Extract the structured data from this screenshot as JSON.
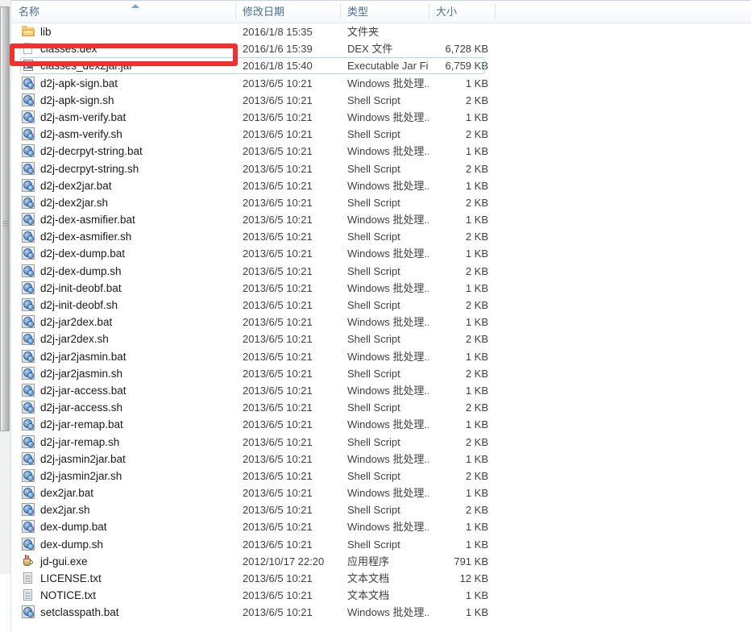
{
  "window": {
    "scrollbar": {
      "orientation": "vertical",
      "position": "left"
    }
  },
  "columns": [
    {
      "key": "name",
      "label": "名称",
      "sorted": "asc"
    },
    {
      "key": "date",
      "label": "修改日期",
      "sorted": ""
    },
    {
      "key": "type",
      "label": "类型",
      "sorted": ""
    },
    {
      "key": "size",
      "label": "大小",
      "sorted": ""
    }
  ],
  "annotation": {
    "color": "#f23030",
    "target": "classes.dex",
    "shape": "rectangle"
  },
  "focused_row": "classes_dex2jar.jar",
  "files": [
    {
      "name": "lib",
      "date": "2016/1/8 15:35",
      "type": "文件夹",
      "size": "",
      "icon": "folder-icon"
    },
    {
      "name": "classes.dex",
      "date": "2016/1/6 15:39",
      "type": "DEX 文件",
      "size": "6,728 KB",
      "icon": "document-icon"
    },
    {
      "name": "classes_dex2jar.jar",
      "date": "2016/1/8 15:40",
      "type": "Executable Jar File",
      "size": "6,759 KB",
      "icon": "jar-icon"
    },
    {
      "name": "d2j-apk-sign.bat",
      "date": "2013/6/5 10:21",
      "type": "Windows 批处理...",
      "size": "1 KB",
      "icon": "batch-script-icon"
    },
    {
      "name": "d2j-apk-sign.sh",
      "date": "2013/6/5 10:21",
      "type": "Shell Script",
      "size": "2 KB",
      "icon": "shell-script-icon"
    },
    {
      "name": "d2j-asm-verify.bat",
      "date": "2013/6/5 10:21",
      "type": "Windows 批处理...",
      "size": "1 KB",
      "icon": "batch-script-icon"
    },
    {
      "name": "d2j-asm-verify.sh",
      "date": "2013/6/5 10:21",
      "type": "Shell Script",
      "size": "2 KB",
      "icon": "shell-script-icon"
    },
    {
      "name": "d2j-decrpyt-string.bat",
      "date": "2013/6/5 10:21",
      "type": "Windows 批处理...",
      "size": "1 KB",
      "icon": "batch-script-icon"
    },
    {
      "name": "d2j-decrpyt-string.sh",
      "date": "2013/6/5 10:21",
      "type": "Shell Script",
      "size": "2 KB",
      "icon": "shell-script-icon"
    },
    {
      "name": "d2j-dex2jar.bat",
      "date": "2013/6/5 10:21",
      "type": "Windows 批处理...",
      "size": "1 KB",
      "icon": "batch-script-icon"
    },
    {
      "name": "d2j-dex2jar.sh",
      "date": "2013/6/5 10:21",
      "type": "Shell Script",
      "size": "2 KB",
      "icon": "shell-script-icon"
    },
    {
      "name": "d2j-dex-asmifier.bat",
      "date": "2013/6/5 10:21",
      "type": "Windows 批处理...",
      "size": "1 KB",
      "icon": "batch-script-icon"
    },
    {
      "name": "d2j-dex-asmifier.sh",
      "date": "2013/6/5 10:21",
      "type": "Shell Script",
      "size": "2 KB",
      "icon": "shell-script-icon"
    },
    {
      "name": "d2j-dex-dump.bat",
      "date": "2013/6/5 10:21",
      "type": "Windows 批处理...",
      "size": "1 KB",
      "icon": "batch-script-icon"
    },
    {
      "name": "d2j-dex-dump.sh",
      "date": "2013/6/5 10:21",
      "type": "Shell Script",
      "size": "2 KB",
      "icon": "shell-script-icon"
    },
    {
      "name": "d2j-init-deobf.bat",
      "date": "2013/6/5 10:21",
      "type": "Windows 批处理...",
      "size": "1 KB",
      "icon": "batch-script-icon"
    },
    {
      "name": "d2j-init-deobf.sh",
      "date": "2013/6/5 10:21",
      "type": "Shell Script",
      "size": "2 KB",
      "icon": "shell-script-icon"
    },
    {
      "name": "d2j-jar2dex.bat",
      "date": "2013/6/5 10:21",
      "type": "Windows 批处理...",
      "size": "1 KB",
      "icon": "batch-script-icon"
    },
    {
      "name": "d2j-jar2dex.sh",
      "date": "2013/6/5 10:21",
      "type": "Shell Script",
      "size": "2 KB",
      "icon": "shell-script-icon"
    },
    {
      "name": "d2j-jar2jasmin.bat",
      "date": "2013/6/5 10:21",
      "type": "Windows 批处理...",
      "size": "1 KB",
      "icon": "batch-script-icon"
    },
    {
      "name": "d2j-jar2jasmin.sh",
      "date": "2013/6/5 10:21",
      "type": "Shell Script",
      "size": "2 KB",
      "icon": "shell-script-icon"
    },
    {
      "name": "d2j-jar-access.bat",
      "date": "2013/6/5 10:21",
      "type": "Windows 批处理...",
      "size": "1 KB",
      "icon": "batch-script-icon"
    },
    {
      "name": "d2j-jar-access.sh",
      "date": "2013/6/5 10:21",
      "type": "Shell Script",
      "size": "2 KB",
      "icon": "shell-script-icon"
    },
    {
      "name": "d2j-jar-remap.bat",
      "date": "2013/6/5 10:21",
      "type": "Windows 批处理...",
      "size": "1 KB",
      "icon": "batch-script-icon"
    },
    {
      "name": "d2j-jar-remap.sh",
      "date": "2013/6/5 10:21",
      "type": "Shell Script",
      "size": "2 KB",
      "icon": "shell-script-icon"
    },
    {
      "name": "d2j-jasmin2jar.bat",
      "date": "2013/6/5 10:21",
      "type": "Windows 批处理...",
      "size": "1 KB",
      "icon": "batch-script-icon"
    },
    {
      "name": "d2j-jasmin2jar.sh",
      "date": "2013/6/5 10:21",
      "type": "Shell Script",
      "size": "2 KB",
      "icon": "shell-script-icon"
    },
    {
      "name": "dex2jar.bat",
      "date": "2013/6/5 10:21",
      "type": "Windows 批处理...",
      "size": "1 KB",
      "icon": "batch-script-icon"
    },
    {
      "name": "dex2jar.sh",
      "date": "2013/6/5 10:21",
      "type": "Shell Script",
      "size": "2 KB",
      "icon": "shell-script-icon"
    },
    {
      "name": "dex-dump.bat",
      "date": "2013/6/5 10:21",
      "type": "Windows 批处理...",
      "size": "1 KB",
      "icon": "batch-script-icon"
    },
    {
      "name": "dex-dump.sh",
      "date": "2013/6/5 10:21",
      "type": "Shell Script",
      "size": "1 KB",
      "icon": "shell-script-icon"
    },
    {
      "name": "jd-gui.exe",
      "date": "2012/10/17 22:20",
      "type": "应用程序",
      "size": "791 KB",
      "icon": "application-icon"
    },
    {
      "name": "LICENSE.txt",
      "date": "2013/6/5 10:21",
      "type": "文本文档",
      "size": "12 KB",
      "icon": "text-document-icon"
    },
    {
      "name": "NOTICE.txt",
      "date": "2013/6/5 10:21",
      "type": "文本文档",
      "size": "1 KB",
      "icon": "text-document-icon"
    },
    {
      "name": "setclasspath.bat",
      "date": "2013/6/5 10:21",
      "type": "Windows 批处理...",
      "size": "1 KB",
      "icon": "batch-script-icon"
    }
  ]
}
